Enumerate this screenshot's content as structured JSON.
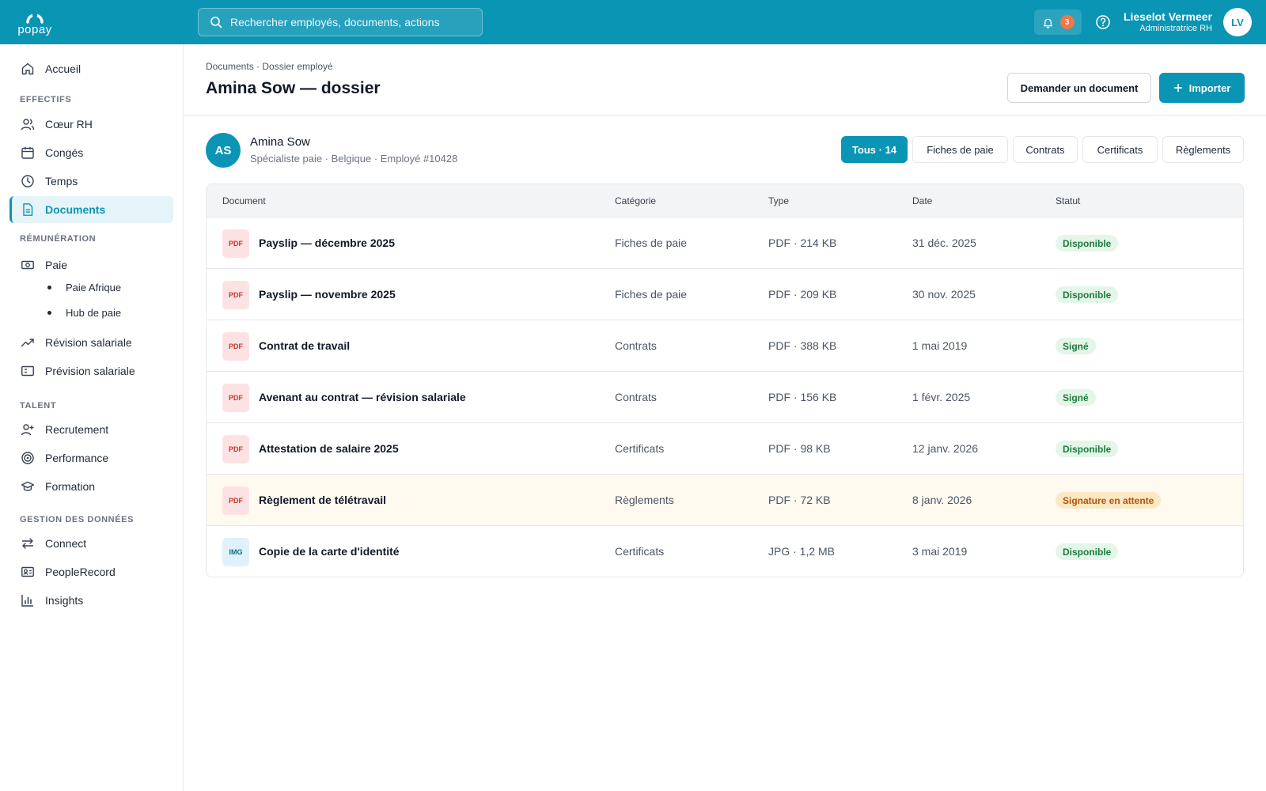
{
  "brand": {
    "name": "popay"
  },
  "search": {
    "placeholder": "Rechercher employés, documents, actions"
  },
  "notifications": {
    "count": "3"
  },
  "user": {
    "name": "Lieselot Vermeer",
    "role": "Administratrice RH",
    "initials": "LV"
  },
  "sidebar": {
    "home": "Accueil",
    "sections": {
      "effectifs": "EFFECTIFS",
      "remuneration": "RÉMUNÉRATION",
      "talent": "TALENT",
      "donnees": "GESTION DES DONNÉES"
    },
    "items": {
      "coeur_rh": "Cœur RH",
      "conges": "Congés",
      "temps": "Temps",
      "documents": "Documents",
      "paie": "Paie",
      "paie_afrique": "Paie Afrique",
      "hub_paie": "Hub de paie",
      "revision": "Révision salariale",
      "prevision": "Prévision salariale",
      "recrutement": "Recrutement",
      "performance": "Performance",
      "formation": "Formation",
      "connect": "Connect",
      "peoplerecord": "PeopleRecord",
      "insights": "Insights"
    }
  },
  "header": {
    "breadcrumb": "Documents · Dossier employé",
    "title": "Amina Sow — dossier",
    "request_label": "Demander un document",
    "import_label": "Importer"
  },
  "employee": {
    "initials": "AS",
    "name": "Amina Sow",
    "subtitle": "Spécialiste paie · Belgique · Employé #10428"
  },
  "filters": [
    "Tous · 14",
    "Fiches de paie",
    "Contrats",
    "Certificats",
    "Règlements"
  ],
  "table": {
    "columns": [
      "Document",
      "Catégorie",
      "Type",
      "Date",
      "Statut"
    ],
    "rows": [
      {
        "icon": "PDF",
        "name": "Payslip — décembre 2025",
        "category": "Fiches de paie",
        "type": "PDF · 214 KB",
        "date": "31 déc. 2025",
        "status": "Disponible"
      },
      {
        "icon": "PDF",
        "name": "Payslip — novembre 2025",
        "category": "Fiches de paie",
        "type": "PDF · 209 KB",
        "date": "30 nov. 2025",
        "status": "Disponible"
      },
      {
        "icon": "PDF",
        "name": "Contrat de travail",
        "category": "Contrats",
        "type": "PDF · 388 KB",
        "date": "1 mai 2019",
        "status": "Signé"
      },
      {
        "icon": "PDF",
        "name": "Avenant au contrat — révision salariale",
        "category": "Contrats",
        "type": "PDF · 156 KB",
        "date": "1 févr. 2025",
        "status": "Signé"
      },
      {
        "icon": "PDF",
        "name": "Attestation de salaire 2025",
        "category": "Certificats",
        "type": "PDF · 98 KB",
        "date": "12 janv. 2026",
        "status": "Disponible"
      },
      {
        "icon": "PDF",
        "name": "Règlement de télétravail",
        "category": "Règlements",
        "type": "PDF · 72 KB",
        "date": "8 janv. 2026",
        "status": "Signature en attente"
      },
      {
        "icon": "IMG",
        "name": "Copie de la carte d'identité",
        "category": "Certificats",
        "type": "JPG · 1,2 MB",
        "date": "3 mai 2019",
        "status": "Disponible"
      }
    ]
  },
  "colors": {
    "brand": "#0b95b4",
    "status_ok": "#1e7a3d",
    "status_pending": "#b45309",
    "notif_badge": "#f0774a"
  }
}
